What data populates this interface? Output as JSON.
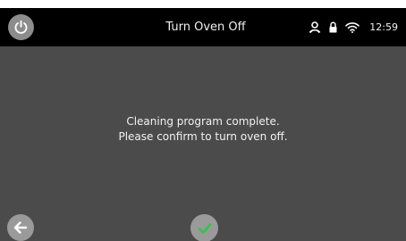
{
  "header": {
    "title": "Turn Oven Off",
    "time": "12:59",
    "icons": {
      "power": "power-icon",
      "user": "user-icon",
      "lock": "lock-icon",
      "wifi": "wifi-icon"
    }
  },
  "main": {
    "message_line1": "Cleaning program complete.",
    "message_line2": "Please confirm to turn oven off."
  },
  "footer": {
    "back_icon": "arrow-left-icon",
    "confirm_icon": "checkmark-icon"
  },
  "colors": {
    "screen_background": "#4b4b4b",
    "top_bar": "#000000",
    "button_gray": "#9a9a9a",
    "confirm_check": "#35c24a",
    "text": "#f0f0f0"
  }
}
